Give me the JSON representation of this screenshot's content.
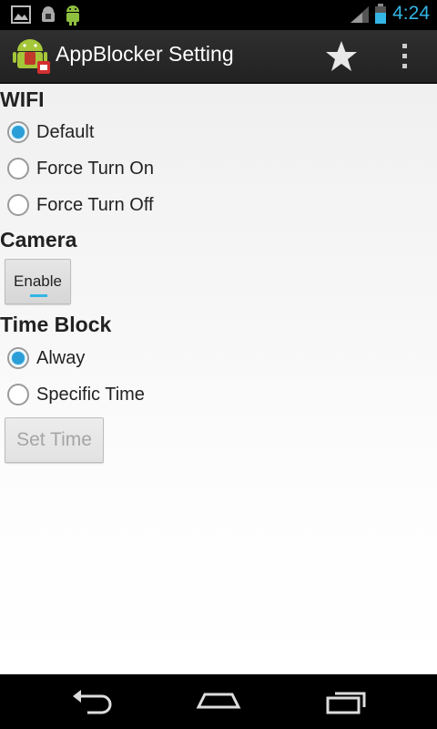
{
  "status_bar": {
    "time": "4:24",
    "icons": [
      "gallery-icon",
      "android-debug-icon",
      "android-robot-icon",
      "signal-icon",
      "battery-icon"
    ]
  },
  "action_bar": {
    "title": "AppBlocker Setting",
    "icons": [
      "app-icon",
      "star-icon",
      "overflow-menu-icon"
    ]
  },
  "wifi": {
    "title": "WIFI",
    "options": [
      "Default",
      "Force Turn On",
      "Force Turn Off"
    ],
    "selected": "Default"
  },
  "camera": {
    "title": "Camera",
    "button_label": "Enable"
  },
  "time_block": {
    "title": "Time Block",
    "options": [
      "Alway",
      "Specific Time"
    ],
    "selected": "Alway",
    "button_label": "Set Time"
  },
  "nav_bar": {
    "icons": [
      "back-icon",
      "home-icon",
      "recent-apps-icon"
    ]
  },
  "colors": {
    "accent": "#33b5e5",
    "radio_checked": "#2b9ed8",
    "action_bar": "#2a2a2a"
  }
}
